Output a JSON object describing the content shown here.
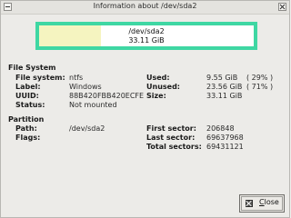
{
  "window": {
    "title": "Information about /dev/sda2"
  },
  "usage_bar": {
    "device": "/dev/sda2",
    "size": "33.11 GiB",
    "used_fraction": 0.29
  },
  "file_system": {
    "heading": "File System",
    "fields": [
      {
        "label": "File system:",
        "value": "ntfs"
      },
      {
        "label": "Label:",
        "value": "Windows"
      },
      {
        "label": "UUID:",
        "value": "88B420FBB420ECFE"
      },
      {
        "label": "Status:",
        "value": "Not mounted"
      }
    ],
    "stats": [
      {
        "label": "Used:",
        "value": "9.55 GiB",
        "percent": "( 29% )"
      },
      {
        "label": "Unused:",
        "value": "23.56 GiB",
        "percent": "( 71% )"
      },
      {
        "label": "Size:",
        "value": "33.11 GiB",
        "percent": ""
      }
    ]
  },
  "partition": {
    "heading": "Partition",
    "fields": [
      {
        "label": "Path:",
        "value": "/dev/sda2"
      },
      {
        "label": "Flags:",
        "value": ""
      }
    ],
    "sectors": [
      {
        "label": "First sector:",
        "value": "206848"
      },
      {
        "label": "Last sector:",
        "value": "69637968"
      },
      {
        "label": "Total sectors:",
        "value": "69431121"
      }
    ]
  },
  "buttons": {
    "close_label": "Close",
    "close_mnemonic": "C",
    "close_rest": "lose"
  },
  "colors": {
    "frame": "#3fd7a3",
    "used": "#f5f4c0"
  }
}
